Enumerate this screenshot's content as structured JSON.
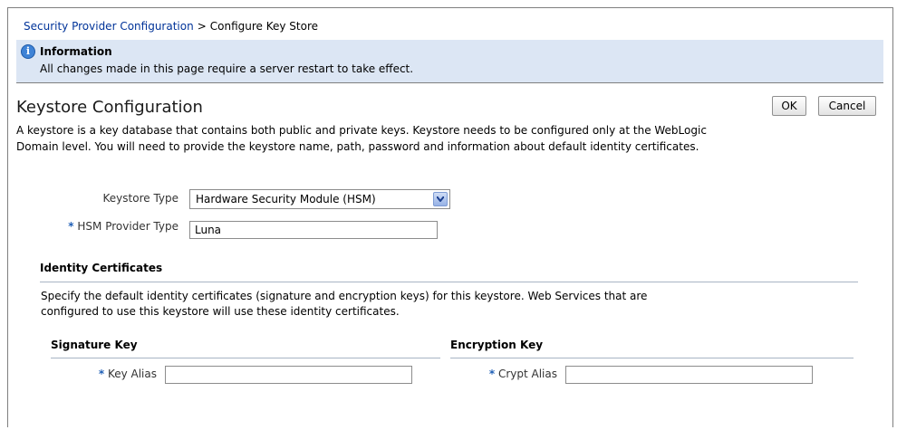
{
  "breadcrumb": {
    "parent": "Security Provider Configuration",
    "separator": ">",
    "current": "Configure Key Store"
  },
  "info": {
    "icon": "info-icon",
    "icon_glyph": "i",
    "title": "Information",
    "message": "All changes made in this page require a server restart to take effect."
  },
  "keystore": {
    "title": "Keystore Configuration",
    "ok_label": "OK",
    "cancel_label": "Cancel",
    "description_line1": "A keystore is a key database that contains both public and private keys. Keystore needs to be configured only at the WebLogic",
    "description_line2": "Domain level. You will need to provide the keystore name, path, password and information about default identity certificates."
  },
  "form": {
    "keystore_type_label": "Keystore Type",
    "keystore_type_value": "Hardware Security Module (HSM)",
    "required_marker": "*",
    "hsm_provider_label": "HSM Provider Type",
    "hsm_provider_value": "Luna"
  },
  "identity": {
    "title": "Identity Certificates",
    "description_line1": "Specify the default identity certificates (signature and encryption keys) for this keystore. Web Services that are",
    "description_line2": "configured to use this keystore will use these identity certificates.",
    "signature": {
      "title": "Signature Key",
      "label": "Key Alias",
      "value": ""
    },
    "encryption": {
      "title": "Encryption Key",
      "label": "Crypt Alias",
      "value": ""
    }
  },
  "colors": {
    "link": "#003399",
    "info_background": "#dce6f4",
    "required": "#1f5fb6"
  }
}
